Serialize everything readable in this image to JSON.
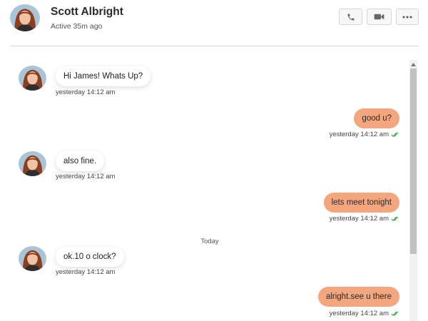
{
  "header": {
    "name": "Scott Albright",
    "status": "Active 35m ago",
    "avatar_icon": "user-avatar-icon",
    "buttons": [
      {
        "icon": "phone-icon"
      },
      {
        "icon": "video-camera-icon"
      },
      {
        "icon": "more-options-icon"
      }
    ]
  },
  "messages": [
    {
      "direction": "incoming",
      "text": "Hi James! Whats Up?",
      "time": "yesterday 14:12 am"
    },
    {
      "direction": "outgoing",
      "text": "good u?",
      "time": "yesterday 14:12 am",
      "status_icon": "double-check-icon"
    },
    {
      "direction": "incoming",
      "text": "also fine.",
      "time": "yesterday 14:12 am"
    },
    {
      "direction": "outgoing",
      "text": "lets meet tonight",
      "time": "yesterday 14:12 am",
      "status_icon": "double-check-icon"
    },
    {
      "direction": "incoming",
      "text": "ok.10 o clock?",
      "time": "yesterday 14:12 am"
    },
    {
      "direction": "outgoing",
      "text": "alright.see u there",
      "time": "yesterday 14:12 am",
      "status_icon": "double-check-icon"
    }
  ],
  "day_separator": "Today",
  "colors": {
    "outgoing_bubble": "#f4a77e",
    "incoming_bubble": "#ffffff",
    "read_check": "#3cb043"
  }
}
